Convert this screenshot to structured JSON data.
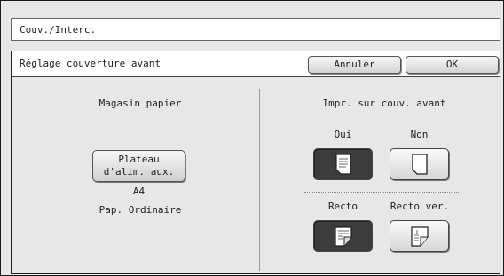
{
  "window": {
    "title": "Couv./Interc."
  },
  "panel": {
    "header": "Réglage couverture avant",
    "cancel_label": "Annuler",
    "ok_label": "OK"
  },
  "left": {
    "section_label": "Magasin papier",
    "tray_button_line1": "Plateau",
    "tray_button_line2": "d'alim. aux.",
    "paper_size": "A4",
    "paper_type": "Pap. Ordinaire"
  },
  "right": {
    "section_label": "Impr. sur couv. avant",
    "yes_label": "Oui",
    "no_label": "Non",
    "yes_selected": true,
    "simplex_label": "Recto",
    "duplex_label": "Recto ver.",
    "simplex_selected": true,
    "icons": [
      "printed-page-icon",
      "blank-page-icon",
      "simplex-page-icon",
      "duplex-page-icon"
    ]
  }
}
